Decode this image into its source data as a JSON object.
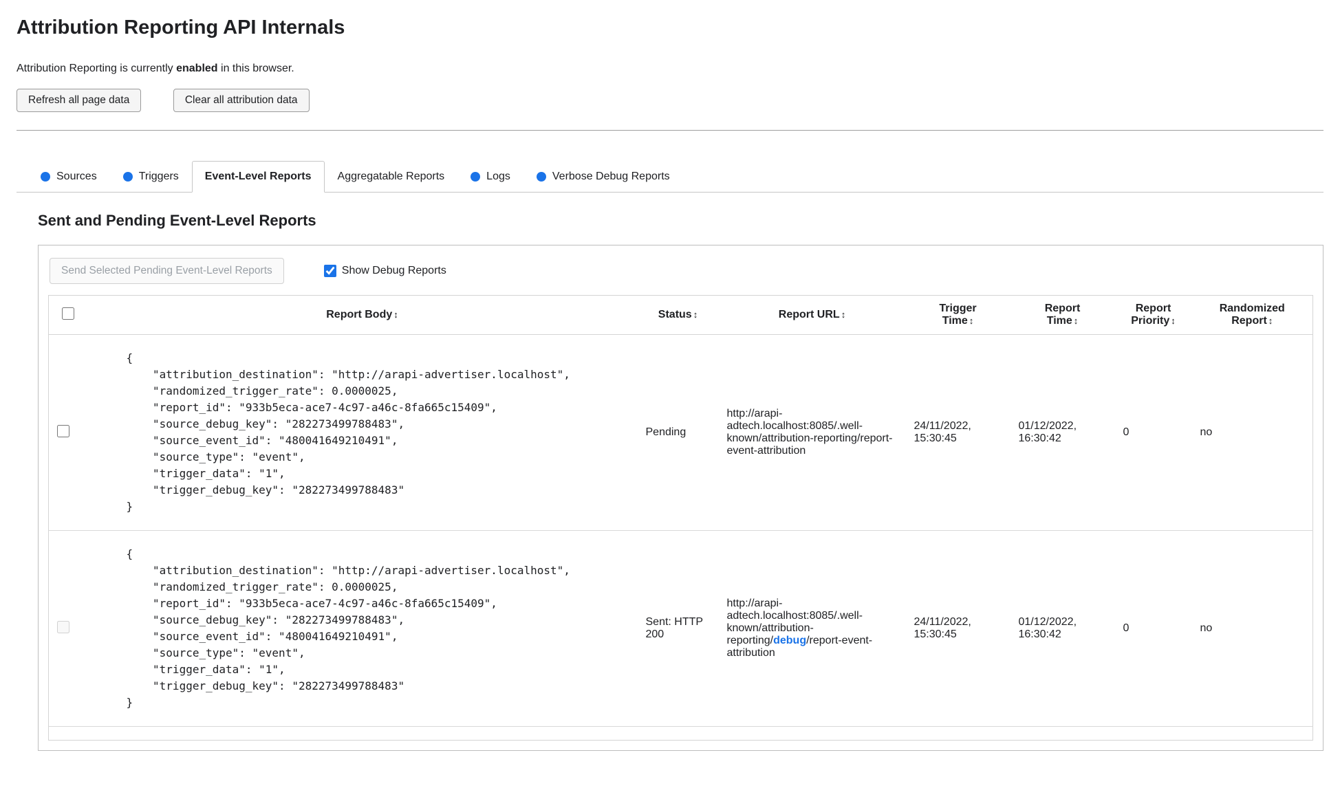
{
  "page": {
    "title": "Attribution Reporting API Internals",
    "status": {
      "prefix": "Attribution Reporting is currently ",
      "emphasis": "enabled",
      "suffix": " in this browser."
    },
    "buttons": {
      "refresh": "Refresh all page data",
      "clear": "Clear all attribution data"
    }
  },
  "tabs": {
    "items": [
      {
        "label": "Sources",
        "dot": true,
        "selected": false
      },
      {
        "label": "Triggers",
        "dot": true,
        "selected": false
      },
      {
        "label": "Event-Level Reports",
        "dot": false,
        "selected": true
      },
      {
        "label": "Aggregatable Reports",
        "dot": false,
        "selected": false
      },
      {
        "label": "Logs",
        "dot": true,
        "selected": false
      },
      {
        "label": "Verbose Debug Reports",
        "dot": true,
        "selected": false
      }
    ]
  },
  "panel": {
    "heading": "Sent and Pending Event-Level Reports",
    "send_button": "Send Selected Pending Event-Level Reports",
    "show_debug_label": "Show Debug Reports",
    "show_debug_checked": true
  },
  "table": {
    "sort_icon": "↕",
    "columns": [
      "Report Body",
      "Status",
      "Report URL",
      "Trigger\nTime",
      "Report\nTime",
      "Report\nPriority",
      "Randomized\nReport"
    ],
    "rows": [
      {
        "checked": false,
        "checkbox_disabled": false,
        "body": "{\n    \"attribution_destination\": \"http://arapi-advertiser.localhost\",\n    \"randomized_trigger_rate\": 0.0000025,\n    \"report_id\": \"933b5eca-ace7-4c97-a46c-8fa665c15409\",\n    \"source_debug_key\": \"282273499788483\",\n    \"source_event_id\": \"480041649210491\",\n    \"source_type\": \"event\",\n    \"trigger_data\": \"1\",\n    \"trigger_debug_key\": \"282273499788483\"\n}",
        "status": "Pending",
        "url": {
          "prefix": "http://arapi-adtech.localhost:8085/.well-known/attribution-reporting/report-event-attribution",
          "link": "",
          "suffix": ""
        },
        "trigger_time": "24/11/2022, 15:30:45",
        "report_time": "01/12/2022, 16:30:42",
        "priority": "0",
        "randomized": "no"
      },
      {
        "checked": false,
        "checkbox_disabled": true,
        "body": "{\n    \"attribution_destination\": \"http://arapi-advertiser.localhost\",\n    \"randomized_trigger_rate\": 0.0000025,\n    \"report_id\": \"933b5eca-ace7-4c97-a46c-8fa665c15409\",\n    \"source_debug_key\": \"282273499788483\",\n    \"source_event_id\": \"480041649210491\",\n    \"source_type\": \"event\",\n    \"trigger_data\": \"1\",\n    \"trigger_debug_key\": \"282273499788483\"\n}",
        "status": "Sent: HTTP 200",
        "url": {
          "prefix": "http://arapi-adtech.localhost:8085/.well-known/attribution-reporting/",
          "link": "debug",
          "suffix": "/report-event-attribution"
        },
        "trigger_time": "24/11/2022, 15:30:45",
        "report_time": "01/12/2022, 16:30:42",
        "priority": "0",
        "randomized": "no"
      }
    ]
  },
  "colors": {
    "accent_blue": "#1a73e8",
    "border_gray": "#bdbdbd",
    "disabled_text": "#9aa0a6"
  }
}
